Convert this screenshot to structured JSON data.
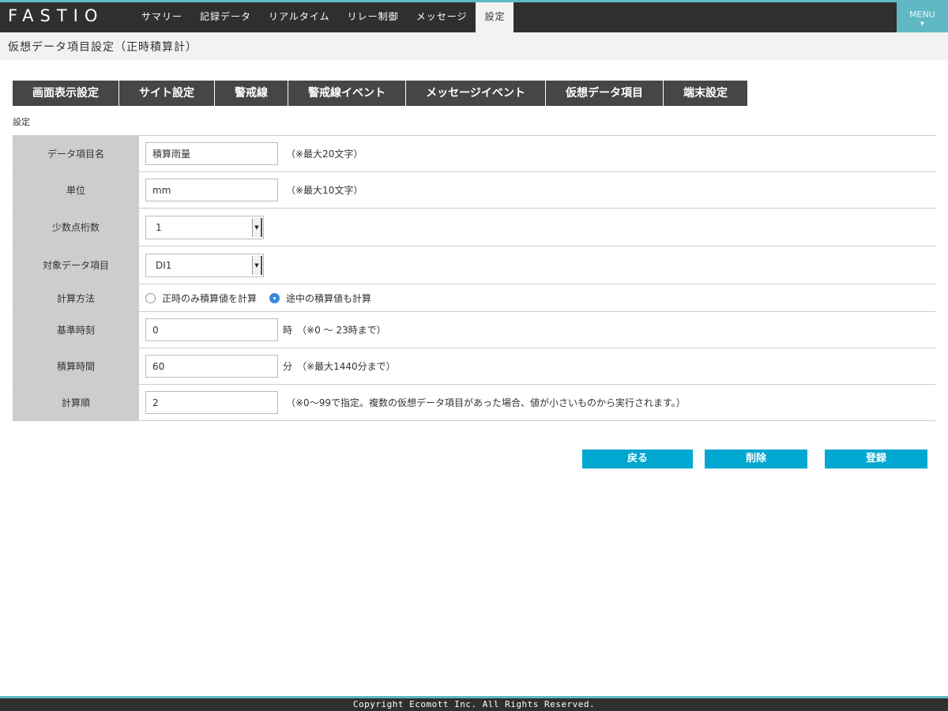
{
  "header": {
    "logo": "FASTIO",
    "nav": [
      {
        "label": "サマリー"
      },
      {
        "label": "記録データ"
      },
      {
        "label": "リアルタイム"
      },
      {
        "label": "リレー制御"
      },
      {
        "label": "メッセージ"
      },
      {
        "label": "設定"
      }
    ],
    "active_nav": "設定",
    "menu_label": "MENU"
  },
  "page_title": "仮想データ項目設定（正時積算計）",
  "tabs": [
    {
      "label": "画面表示設定"
    },
    {
      "label": "サイト設定"
    },
    {
      "label": "警戒線"
    },
    {
      "label": "警戒線イベント"
    },
    {
      "label": "メッセージイベント"
    },
    {
      "label": "仮想データ項目"
    },
    {
      "label": "端末設定"
    }
  ],
  "section_label": "設定",
  "form": {
    "item_name": {
      "label": "データ項目名",
      "value": "積算雨量",
      "note": "（※最大20文字）"
    },
    "unit": {
      "label": "単位",
      "value": "mm",
      "note": "（※最大10文字）"
    },
    "decimals": {
      "label": "少数点桁数",
      "selected": "1"
    },
    "target": {
      "label": "対象データ項目",
      "selected": "DI1"
    },
    "method": {
      "label": "計算方法",
      "options": [
        {
          "label": "正時のみ積算値を計算",
          "checked": false
        },
        {
          "label": "途中の積算値も計算",
          "checked": true
        }
      ]
    },
    "base_time": {
      "label": "基準時刻",
      "value": "0",
      "suffix": "時",
      "note": "（※0 ～ 23時まで）"
    },
    "duration": {
      "label": "積算時間",
      "value": "60",
      "suffix": "分",
      "note": "（※最大1440分まで）"
    },
    "order": {
      "label": "計算順",
      "value": "2",
      "note": "（※0～99で指定。複数の仮想データ項目があった場合、値が小さいものから実行されます。）"
    }
  },
  "buttons": {
    "back": "戻る",
    "delete": "削除",
    "register": "登録"
  },
  "footer": "Copyright Ecomott Inc. All Rights Reserved.",
  "colors": {
    "header_bg": "#2f2f2f",
    "accent": "#5fb8c4",
    "button": "#00a7d0",
    "tab_bg": "#464646",
    "label_bg": "#cdcdcd",
    "radio_checked": "#3a87d8"
  },
  "icons": {
    "select_arrow": "chevron-down-icon",
    "menu_caret": "caret-down-icon"
  }
}
